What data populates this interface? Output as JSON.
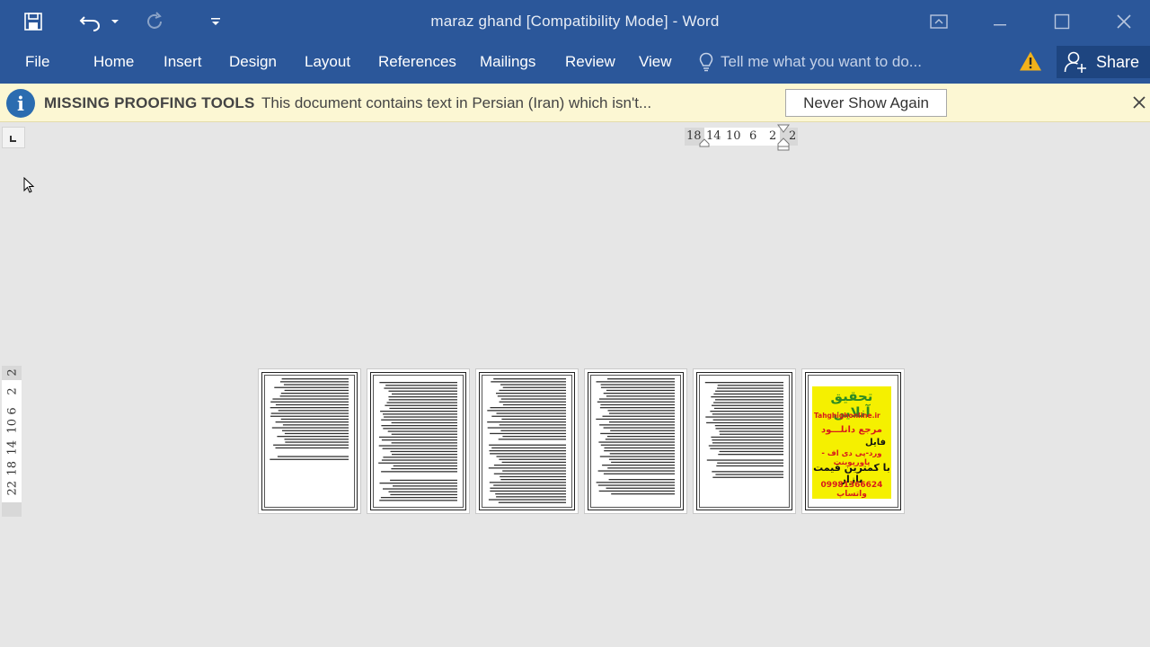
{
  "window": {
    "title": "maraz ghand [Compatibility Mode] - Word"
  },
  "ribbon": {
    "tabs": [
      "File",
      "Home",
      "Insert",
      "Design",
      "Layout",
      "References",
      "Mailings",
      "Review",
      "View"
    ],
    "tell_me_placeholder": "Tell me what you want to do...",
    "share_label": "Share"
  },
  "message_bar": {
    "title": "MISSING PROOFING TOOLS",
    "text": "This document contains text in Persian (Iran) which isn't...",
    "button_label": "Never Show Again"
  },
  "horizontal_ruler": {
    "labels": [
      "18",
      "14",
      "10",
      "6",
      "2",
      "2"
    ]
  },
  "vertical_ruler": {
    "labels": [
      "2",
      "2",
      "6",
      "10",
      "14",
      "18",
      "22"
    ]
  },
  "pages": {
    "count": 6,
    "ad_page": {
      "line1": "تحقیق آنلاین",
      "line2": "Tahghighonline.ir",
      "line3": "مرجع دانلـــود",
      "line4": "فایل",
      "line5": "ورد-پی دی اف - پاورپوینت",
      "line6": "با کمترین قیمت بازار",
      "line7": "09981366624 واتساپ"
    }
  },
  "colors": {
    "ribbon_blue": "#2b579a",
    "message_bar_yellow": "#fcf7d3",
    "warning_yellow": "#f2b21a",
    "ad_yellow": "#f5f000"
  }
}
